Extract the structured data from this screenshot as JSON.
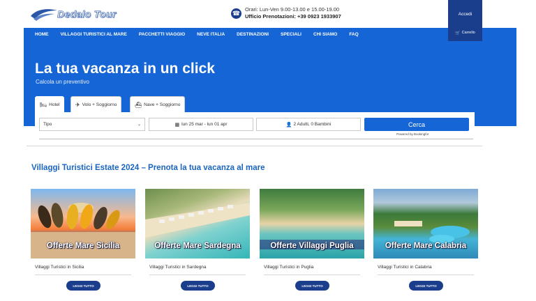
{
  "header": {
    "logo_text": "Dedalo Tour",
    "hours_line1": "Orari: Lun-Ven 9.00-13.00 e 15.00-19.00",
    "hours_line2": "Ufficio Prenotazioni: +39 0923 1933907",
    "login_label": "Accedi",
    "cart_label": "Carrello"
  },
  "nav": {
    "items": [
      "HOME",
      "VILLAGGI TURISTICI AL MARE",
      "PACCHETTI VIAGGIO",
      "NEVE ITALIA",
      "DESTINAZIONI",
      "SPECIALI",
      "CHI SIAMO",
      "FAQ"
    ]
  },
  "hero": {
    "title": "La tua vacanza in un click",
    "subtitle": "Calcola un preventivo"
  },
  "search": {
    "tabs": [
      "Hotel",
      "Volo + Soggiorno",
      "Nave + Soggiorno"
    ],
    "type_placeholder": "Tipo",
    "dates": "lun 25 mar - lun 01 apr",
    "guests": "2 Adulti, 0 Bambini",
    "submit_label": "Cerca",
    "powered_by": "Powered by Bookingfor"
  },
  "section": {
    "title": "Villaggi Turistici Estate 2024 – Prenota la tua vacanza al mare"
  },
  "cards": [
    {
      "overlay": "Offerte Mare Sicilia",
      "caption": "Villaggi Turistici in Sicilia",
      "button": "LEGGI TUTTO"
    },
    {
      "overlay": "Offerte Mare Sardegna",
      "caption": "Villaggi Turistici in Sardegna",
      "button": "LEGGI TUTTO"
    },
    {
      "overlay": "Offerte Villaggi Puglia",
      "caption": "Villaggi Turistici in Puglia",
      "button": "LEGGI TUTTO"
    },
    {
      "overlay": "Offerte Mare Calabria",
      "caption": "Villaggi Turistici in Calabria",
      "button": "LEGGI TUTTO"
    }
  ],
  "colors": {
    "brand_blue": "#1565d6",
    "dark_blue": "#1a3e8c",
    "title_blue": "#1a65c0"
  },
  "icons": {
    "phone": "phone-icon",
    "hotel": "bed-icon",
    "flight": "plane-icon",
    "ferry": "ship-icon",
    "calendar": "calendar-icon",
    "user": "user-icon",
    "cart": "cart-icon",
    "chevron": "chevron-down-icon"
  }
}
